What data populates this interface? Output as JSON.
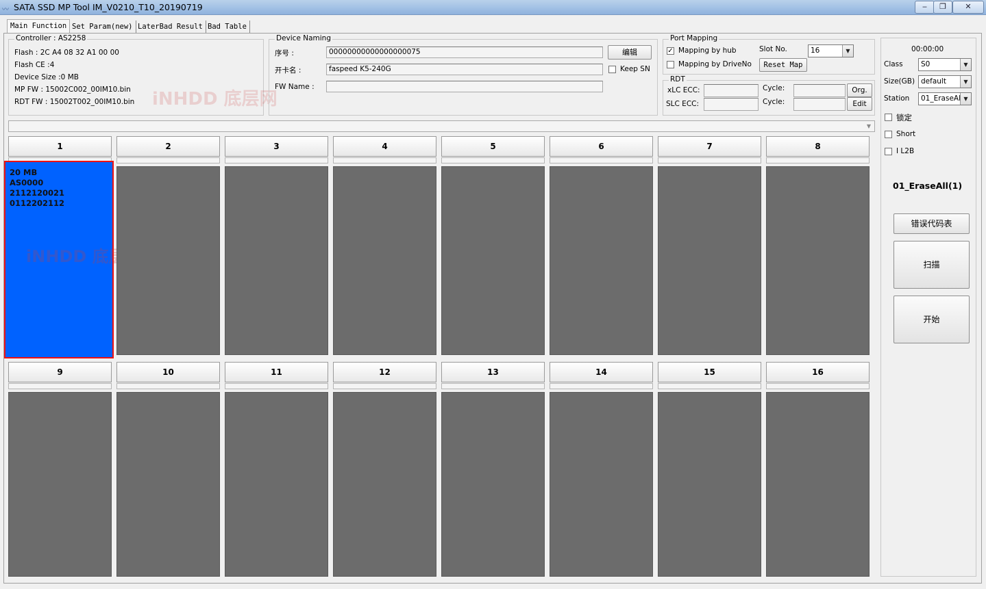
{
  "window": {
    "title": "SATA SSD MP Tool IM_V0210_T10_20190719",
    "min": "‒",
    "max": "❐",
    "close": "✕"
  },
  "tabs": [
    "Main Function",
    "Set Param(new)",
    "LaterBad Result",
    "Bad Table"
  ],
  "controller": {
    "title": "Controller : AS2258",
    "flash": "Flash :  2C A4 08 32 A1 00 00",
    "flash_ce": "Flash CE :4",
    "device_size": "Device Size :0 MB",
    "mp_fw": "MP FW :   15002C002_00IM10.bin",
    "rdt_fw": "RDT FW : 15002T002_00IM10.bin"
  },
  "device_naming": {
    "title": "Device Naming",
    "serial_label": "序号 :",
    "serial_value": "00000000000000000075",
    "card_label": "开卡名 :",
    "card_value": "faspeed K5-240G",
    "fw_label": "FW Name :",
    "fw_value": "",
    "edit_button": "编辑",
    "keep_sn": "Keep SN"
  },
  "port_mapping": {
    "title": "Port Mapping",
    "by_hub": "Mapping by hub",
    "by_hub_checked": "✓",
    "by_driveno": "Mapping by DriveNo",
    "slot_label": "Slot No.",
    "slot_value": "16",
    "reset_map": "Reset Map"
  },
  "rdt": {
    "title": "RDT",
    "xlc_label": "xLC ECC:",
    "slc_label": "SLC ECC:",
    "cycle1_label": "Cycle:",
    "cycle2_label": "Cycle:",
    "org_button": "Org.",
    "edit_button": "Edit"
  },
  "right_panel": {
    "timer": "00:00:00",
    "class_label": "Class",
    "class_value": "S0",
    "size_label": "Size(GB)",
    "size_value": "default",
    "station_label": "Station",
    "station_value": "01_EraseAl",
    "lock_label": "锁定",
    "short_label": "Short",
    "il2b_label": "I L2B",
    "mode_text": "01_EraseAll(1)",
    "error_table_button": "错误代码表",
    "scan_button": "扫描",
    "start_button": "开始"
  },
  "slots": [
    {
      "label": "1",
      "info": [
        "20 MB",
        "AS0000",
        "2112120021",
        "0112202112"
      ],
      "active": true
    },
    {
      "label": "2",
      "info": [],
      "active": false
    },
    {
      "label": "3",
      "info": [],
      "active": false
    },
    {
      "label": "4",
      "info": [],
      "active": false
    },
    {
      "label": "5",
      "info": [],
      "active": false
    },
    {
      "label": "6",
      "info": [],
      "active": false
    },
    {
      "label": "7",
      "info": [],
      "active": false
    },
    {
      "label": "8",
      "info": [],
      "active": false
    },
    {
      "label": "9",
      "info": [],
      "active": false
    },
    {
      "label": "10",
      "info": [],
      "active": false
    },
    {
      "label": "11",
      "info": [],
      "active": false
    },
    {
      "label": "12",
      "info": [],
      "active": false
    },
    {
      "label": "13",
      "info": [],
      "active": false
    },
    {
      "label": "14",
      "info": [],
      "active": false
    },
    {
      "label": "15",
      "info": [],
      "active": false
    },
    {
      "label": "16",
      "info": [],
      "active": false
    }
  ],
  "watermark": "iNHDD 底层网",
  "colors": {
    "active_slot": "#0062ff",
    "idle_slot": "#6c6c6c",
    "highlight_border": "#ee1111"
  }
}
